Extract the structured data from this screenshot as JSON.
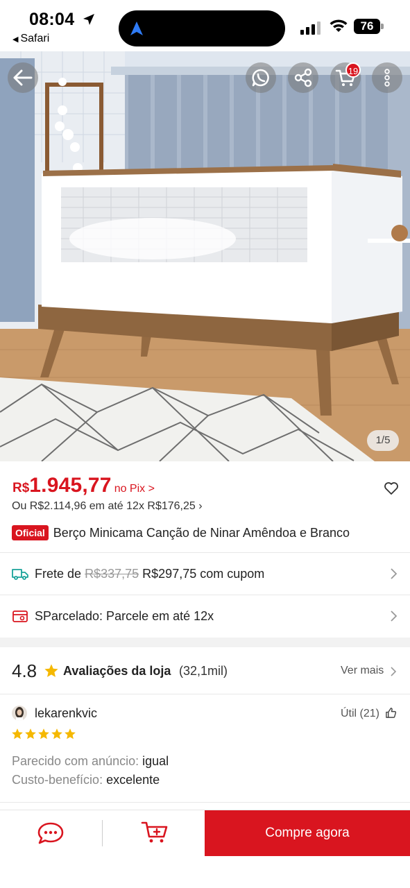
{
  "status_bar": {
    "time": "08:04",
    "back_app": "Safari",
    "battery": "76"
  },
  "hero": {
    "image_counter": "1/5",
    "cart_badge": "19"
  },
  "product": {
    "price_currency": "R$",
    "price_value": "1.945,77",
    "price_suffix": "no Pix >",
    "installment": "Ou R$2.114,96 em até 12x R$176,25 ›",
    "official_badge": "Oficial",
    "title": "Berço Minicama Canção de Ninar Amêndoa e Branco"
  },
  "shipping": {
    "label": "Frete de",
    "old_price": "R$337,75",
    "new_price": "R$297,75 com cupom"
  },
  "sparcelado": {
    "label": "SParcelado: Parcele em até 12x"
  },
  "reviews": {
    "rating": "4.8",
    "label": "Avaliações da loja",
    "count": "(32,1mil)",
    "see_more": "Ver mais",
    "reviewer": "lekarenkvic",
    "helpful": "Útil (21)",
    "stars": 5,
    "attr1_key": "Parecido com anúncio:",
    "attr1_val": "igual",
    "attr2_key": "Custo-benefício:",
    "attr2_val": "excelente"
  },
  "bottom_bar": {
    "buy_label": "Compre agora"
  },
  "colors": {
    "accent": "#d9151f",
    "star": "#f5b800"
  },
  "icons": [
    "back-arrow-icon",
    "whatsapp-icon",
    "share-icon",
    "cart-icon",
    "more-icon",
    "heart-icon",
    "truck-icon",
    "card-icon",
    "chevron-right-icon",
    "star-icon",
    "thumb-up-icon",
    "chat-icon",
    "add-cart-icon"
  ]
}
